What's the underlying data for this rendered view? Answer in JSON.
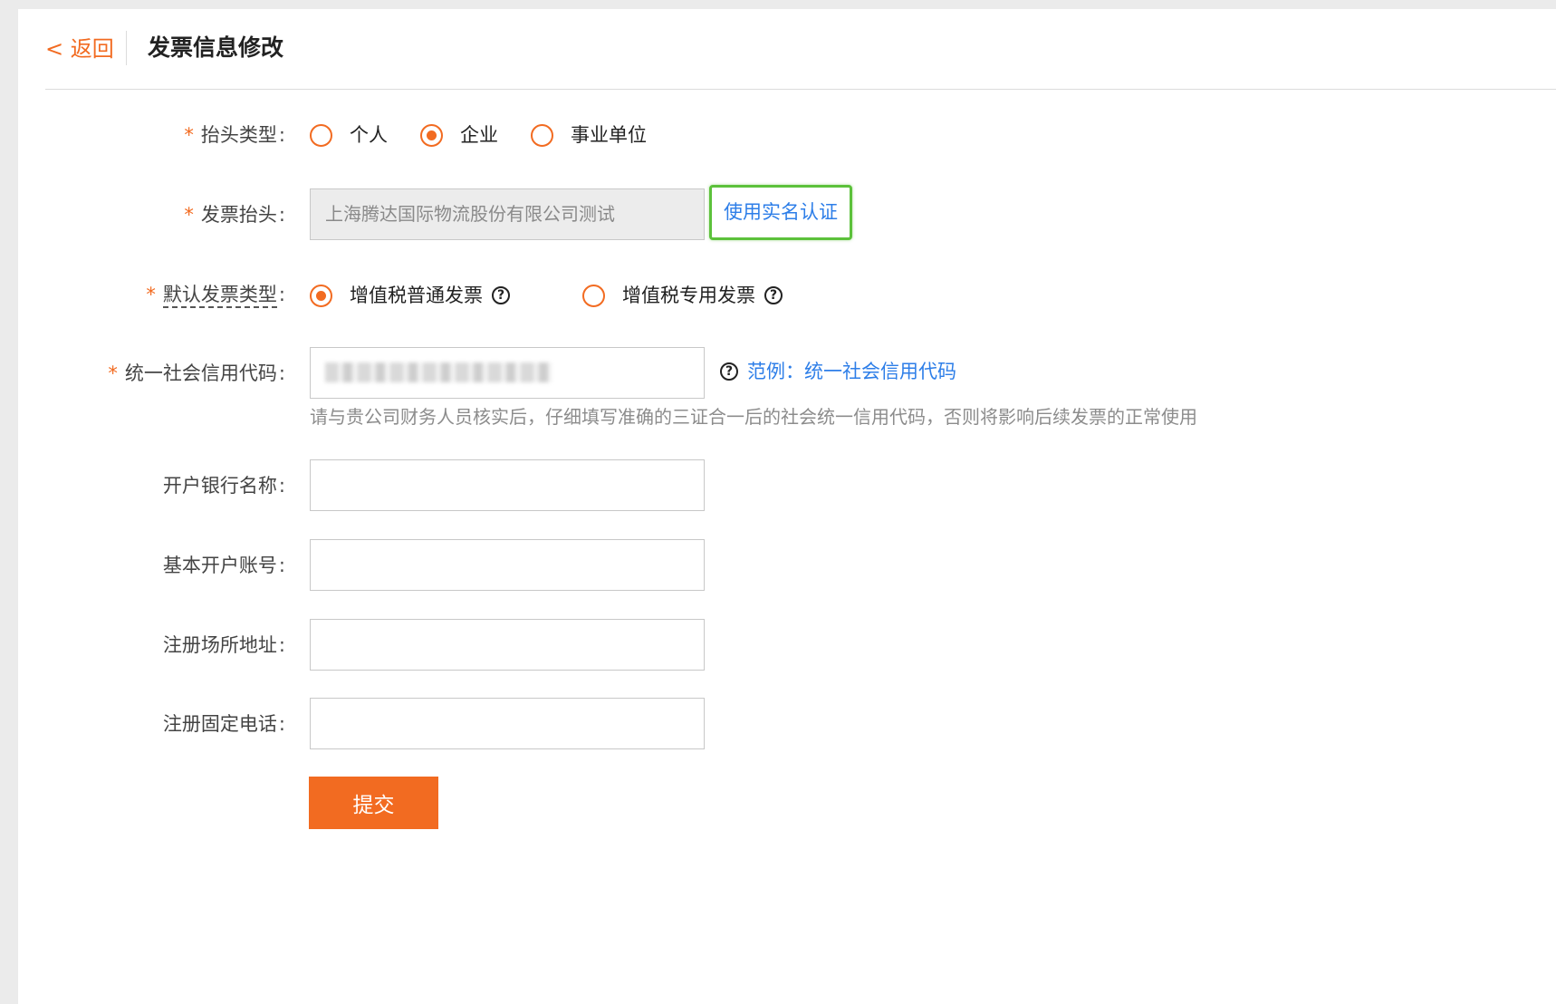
{
  "header": {
    "back_label": "< 返回",
    "title": "发票信息修改"
  },
  "form": {
    "required_mark": "*",
    "colon": ":",
    "title_type": {
      "label": "抬头类型",
      "options": [
        "个人",
        "企业",
        "事业单位"
      ],
      "selected": "企业"
    },
    "invoice_title": {
      "label": "发票抬头",
      "value": "上海腾达国际物流股份有限公司测试",
      "verify_button": "使用实名认证"
    },
    "default_invoice_type": {
      "label": "默认发票类型",
      "options": [
        "增值税普通发票",
        "增值税专用发票"
      ],
      "selected": "增值税普通发票"
    },
    "credit_code": {
      "label": "统一社会信用代码",
      "example_link": "范例：统一社会信用代码",
      "hint": "请与贵公司财务人员核实后，仔细填写准确的三证合一后的社会统一信用代码，否则将影响后续发票的正常使用"
    },
    "bank_name": {
      "label": "开户银行名称",
      "value": ""
    },
    "bank_account": {
      "label": "基本开户账号",
      "value": ""
    },
    "registered_address": {
      "label": "注册场所地址",
      "value": ""
    },
    "registered_phone": {
      "label": "注册固定电话",
      "value": ""
    },
    "submit_label": "提交"
  },
  "icons": {
    "help": "question-circle-icon"
  },
  "colors": {
    "accent": "#f26b21",
    "link": "#2d7ee8",
    "highlight": "#5cc13b"
  }
}
